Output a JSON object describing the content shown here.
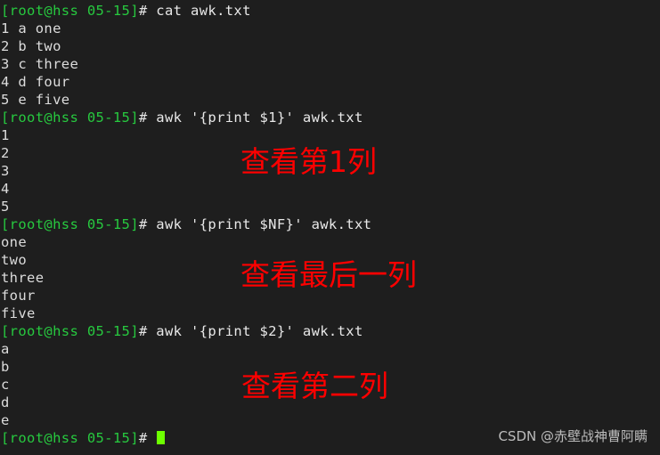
{
  "terminal": {
    "background_color": "#1e1e1e",
    "prompt_color": "#27c93f",
    "text_color": "#dcdcdc",
    "cursor_color": "#6dff00",
    "annotation_color": "#ff0000",
    "prompt": "[root@hss 05-15]",
    "prompt_suffix": "#",
    "lines": [
      {
        "type": "prompt",
        "command": " cat awk.txt"
      },
      {
        "type": "output",
        "text": "1 a one"
      },
      {
        "type": "output",
        "text": "2 b two"
      },
      {
        "type": "output",
        "text": "3 c three"
      },
      {
        "type": "output",
        "text": "4 d four"
      },
      {
        "type": "output",
        "text": "5 e five"
      },
      {
        "type": "prompt",
        "command": " awk '{print $1}' awk.txt"
      },
      {
        "type": "output",
        "text": "1"
      },
      {
        "type": "output",
        "text": "2"
      },
      {
        "type": "output",
        "text": "3"
      },
      {
        "type": "output",
        "text": "4"
      },
      {
        "type": "output",
        "text": "5"
      },
      {
        "type": "prompt",
        "command": " awk '{print $NF}' awk.txt"
      },
      {
        "type": "output",
        "text": "one"
      },
      {
        "type": "output",
        "text": "two"
      },
      {
        "type": "output",
        "text": "three"
      },
      {
        "type": "output",
        "text": "four"
      },
      {
        "type": "output",
        "text": "five"
      },
      {
        "type": "prompt",
        "command": " awk '{print $2}' awk.txt"
      },
      {
        "type": "output",
        "text": "a"
      },
      {
        "type": "output",
        "text": "b"
      },
      {
        "type": "output",
        "text": "c"
      },
      {
        "type": "output",
        "text": "d"
      },
      {
        "type": "output",
        "text": "e"
      },
      {
        "type": "prompt",
        "command": " ",
        "cursor": true
      }
    ]
  },
  "annotations": [
    {
      "id": "ann-1",
      "text": "查看第1列"
    },
    {
      "id": "ann-2",
      "text": "查看最后一列"
    },
    {
      "id": "ann-3",
      "text": "查看第二列"
    }
  ],
  "watermark": {
    "text": "CSDN @赤壁战神曹阿瞒"
  }
}
